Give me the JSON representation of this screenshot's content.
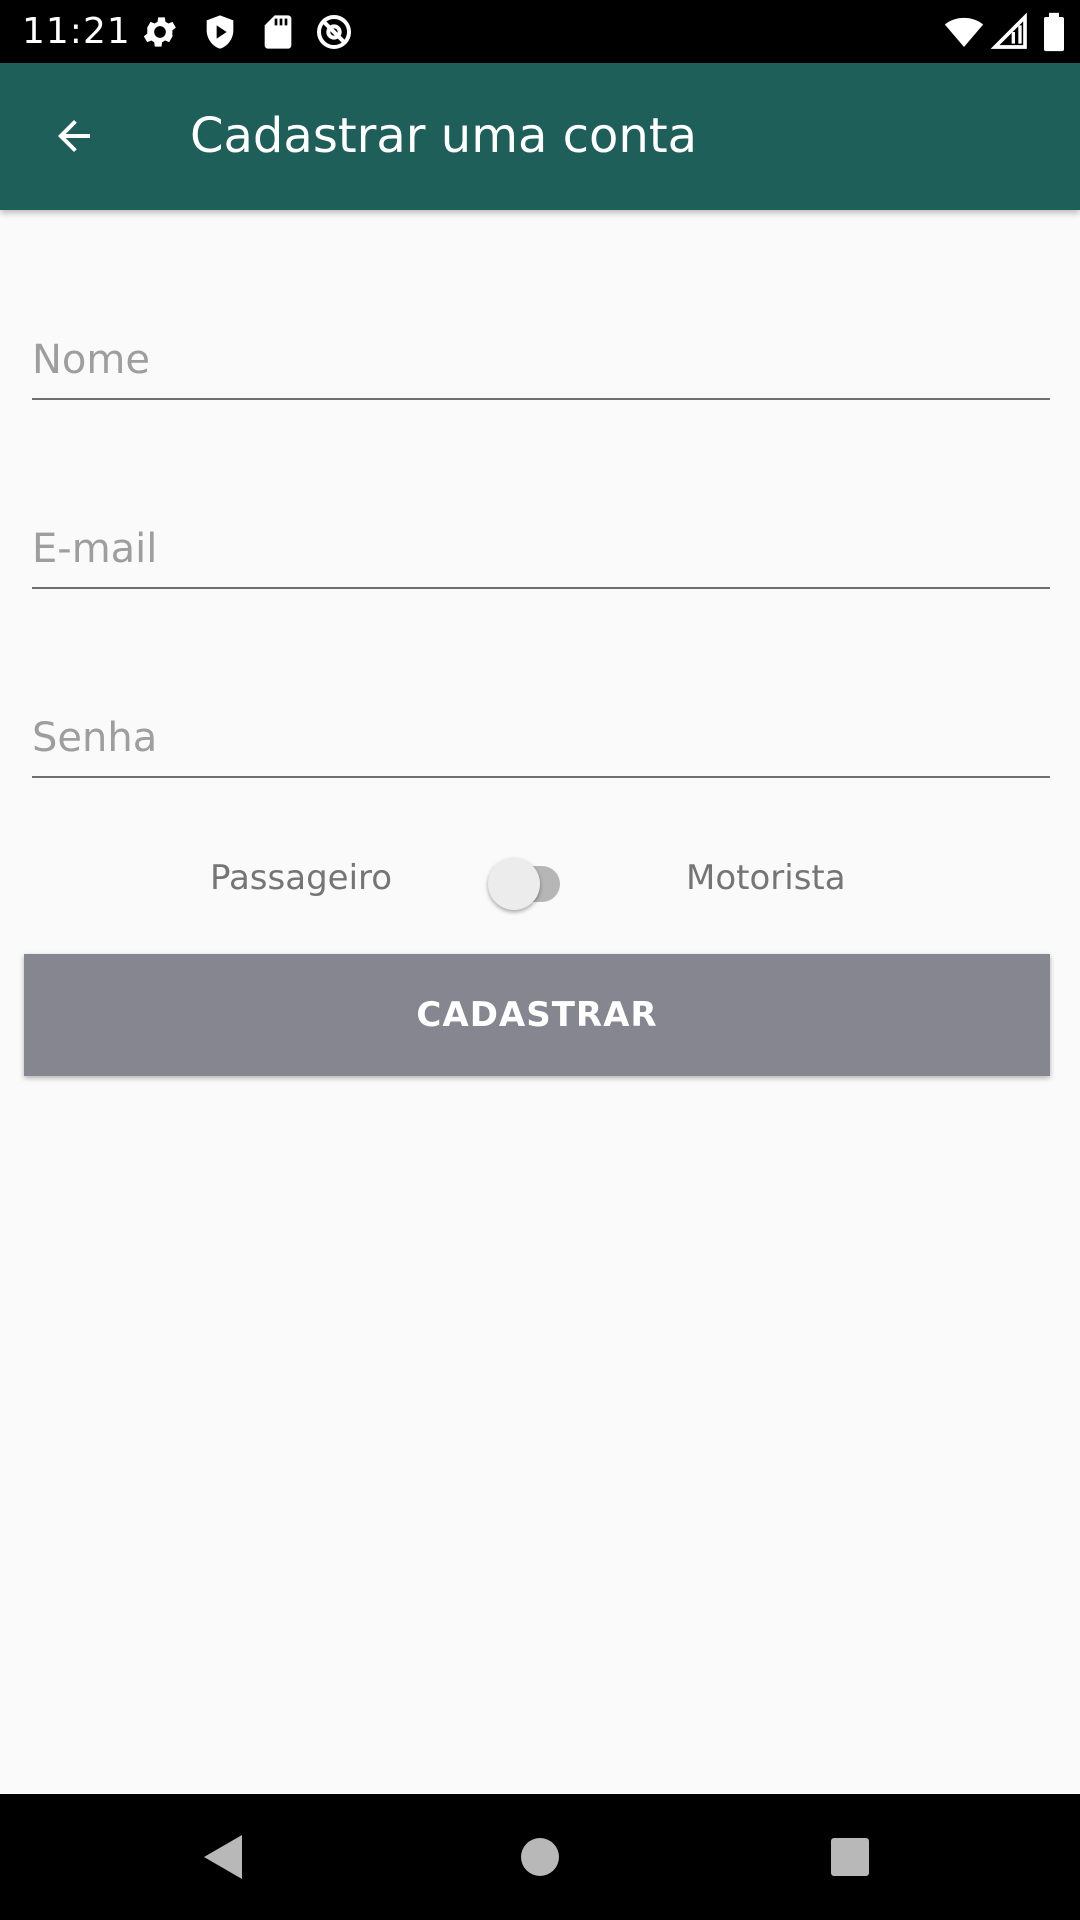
{
  "status_bar": {
    "time": "11:21",
    "left_icons": [
      "gear-icon",
      "shield-icon",
      "sd-card-icon",
      "at-sign-icon"
    ],
    "right_icons": [
      "wifi-icon",
      "signal-icon",
      "battery-icon"
    ]
  },
  "app_bar": {
    "title": "Cadastrar uma conta",
    "back_icon": "arrow-back-icon",
    "background": "#1e5f5a"
  },
  "form": {
    "name": {
      "value": "",
      "placeholder": "Nome"
    },
    "email": {
      "value": "",
      "placeholder": "E-mail"
    },
    "password": {
      "value": "",
      "placeholder": "Senha"
    },
    "toggle": {
      "left_label": "Passageiro",
      "right_label": "Motorista",
      "checked": false
    },
    "submit_label": "CADASTRAR"
  },
  "colors": {
    "primary": "#1e5f5a",
    "button": "#868690",
    "background": "#fafafa"
  },
  "nav_bar": {
    "icons": [
      "back-triangle-icon",
      "home-circle-icon",
      "recents-square-icon"
    ]
  }
}
